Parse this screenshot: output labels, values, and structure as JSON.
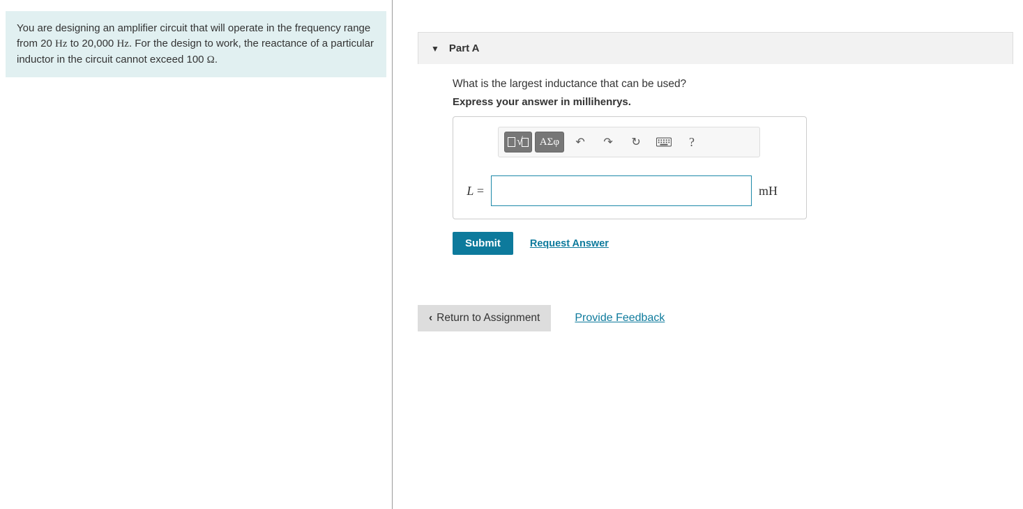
{
  "problem": {
    "text_1": "You are designing an amplifier circuit that will operate in the frequency range from 20 ",
    "hz1": "Hz",
    "text_2": " to 20,000 ",
    "hz2": "Hz",
    "text_3": ". For the design to work, the reactance of a particular inductor in the circuit cannot exceed 100 ",
    "ohm": "Ω",
    "text_4": "."
  },
  "part": {
    "label": "Part A",
    "question": "What is the largest inductance that can be used?",
    "instruction": "Express your answer in millihenrys.",
    "variable": "L",
    "equals": " = ",
    "unit": "mH",
    "input_value": ""
  },
  "toolbar": {
    "greek_label": "ΑΣφ",
    "help_label": "?"
  },
  "actions": {
    "submit": "Submit",
    "request_answer": "Request Answer",
    "return": "Return to Assignment",
    "feedback": "Provide Feedback"
  }
}
